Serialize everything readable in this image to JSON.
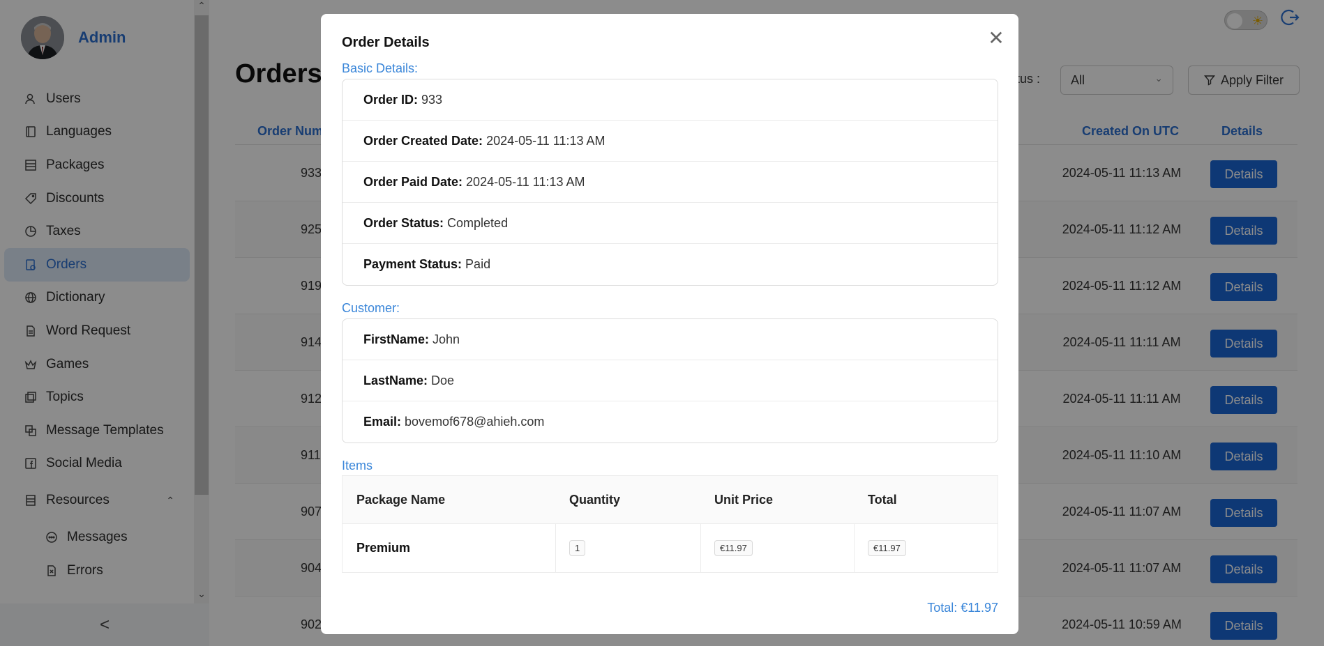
{
  "sidebar": {
    "admin_name": "Admin",
    "items": [
      {
        "label": "Users",
        "icon": "user-icon"
      },
      {
        "label": "Languages",
        "icon": "book-icon"
      },
      {
        "label": "Packages",
        "icon": "package-icon"
      },
      {
        "label": "Discounts",
        "icon": "tag-icon"
      },
      {
        "label": "Taxes",
        "icon": "pie-chart-icon"
      },
      {
        "label": "Orders",
        "icon": "order-icon",
        "active": true
      },
      {
        "label": "Dictionary",
        "icon": "globe-icon"
      },
      {
        "label": "Word Request",
        "icon": "document-icon"
      },
      {
        "label": "Games",
        "icon": "crown-icon"
      },
      {
        "label": "Topics",
        "icon": "copy-icon"
      },
      {
        "label": "Message Templates",
        "icon": "template-icon"
      },
      {
        "label": "Social Media",
        "icon": "facebook-icon"
      },
      {
        "label": "Resources",
        "icon": "database-icon",
        "expanded": true
      }
    ],
    "sub_items": [
      {
        "label": "Messages",
        "icon": "chat-icon"
      },
      {
        "label": "Errors",
        "icon": "error-file-icon"
      }
    ],
    "collapse_glyph": "<"
  },
  "main": {
    "page_title": "Orders",
    "filter": {
      "label": "Status :",
      "selected": "All"
    },
    "apply_filter_label": "Apply Filter",
    "table": {
      "headers": {
        "order_number": "Order Number",
        "created_on": "Created On UTC",
        "details": "Details"
      },
      "rows": [
        {
          "order_number": "933",
          "created_on": "2024-05-11 11:13 AM",
          "action": "Details"
        },
        {
          "order_number": "925",
          "created_on": "2024-05-11 11:12 AM",
          "action": "Details"
        },
        {
          "order_number": "919",
          "created_on": "2024-05-11 11:12 AM",
          "action": "Details"
        },
        {
          "order_number": "914",
          "created_on": "2024-05-11 11:11 AM",
          "action": "Details"
        },
        {
          "order_number": "912",
          "created_on": "2024-05-11 11:11 AM",
          "action": "Details"
        },
        {
          "order_number": "911",
          "created_on": "2024-05-11 11:10 AM",
          "action": "Details"
        },
        {
          "order_number": "907",
          "created_on": "2024-05-11 11:07 AM",
          "action": "Details"
        },
        {
          "order_number": "904",
          "created_on": "2024-05-11 11:07 AM",
          "action": "Details"
        },
        {
          "order_number": "902",
          "created_on": "2024-05-11 10:59 AM",
          "action": "Details"
        }
      ]
    }
  },
  "modal": {
    "title": "Order Details",
    "basic_label": "Basic Details:",
    "basic": [
      {
        "key": "Order ID:",
        "value": "933"
      },
      {
        "key": "Order Created Date:",
        "value": "2024-05-11 11:13 AM"
      },
      {
        "key": "Order Paid Date:",
        "value": "2024-05-11 11:13 AM"
      },
      {
        "key": "Order Status:",
        "value": "Completed"
      },
      {
        "key": "Payment Status:",
        "value": "Paid"
      }
    ],
    "customer_label": "Customer:",
    "customer": [
      {
        "key": "FirstName:",
        "value": "John"
      },
      {
        "key": "LastName:",
        "value": "Doe"
      },
      {
        "key": "Email:",
        "value": "bovemof678@ahieh.com"
      }
    ],
    "items_label": "Items",
    "items_headers": [
      "Package Name",
      "Quantity",
      "Unit Price",
      "Total"
    ],
    "items": [
      {
        "package_name": "Premium",
        "quantity": "1",
        "unit_price": "€11.97",
        "total": "€11.97"
      }
    ],
    "grand_total": "Total: €11.97"
  },
  "colors": {
    "accent": "#2d6fd0",
    "button": "#1b67d6",
    "section_label": "#3a86d9"
  }
}
